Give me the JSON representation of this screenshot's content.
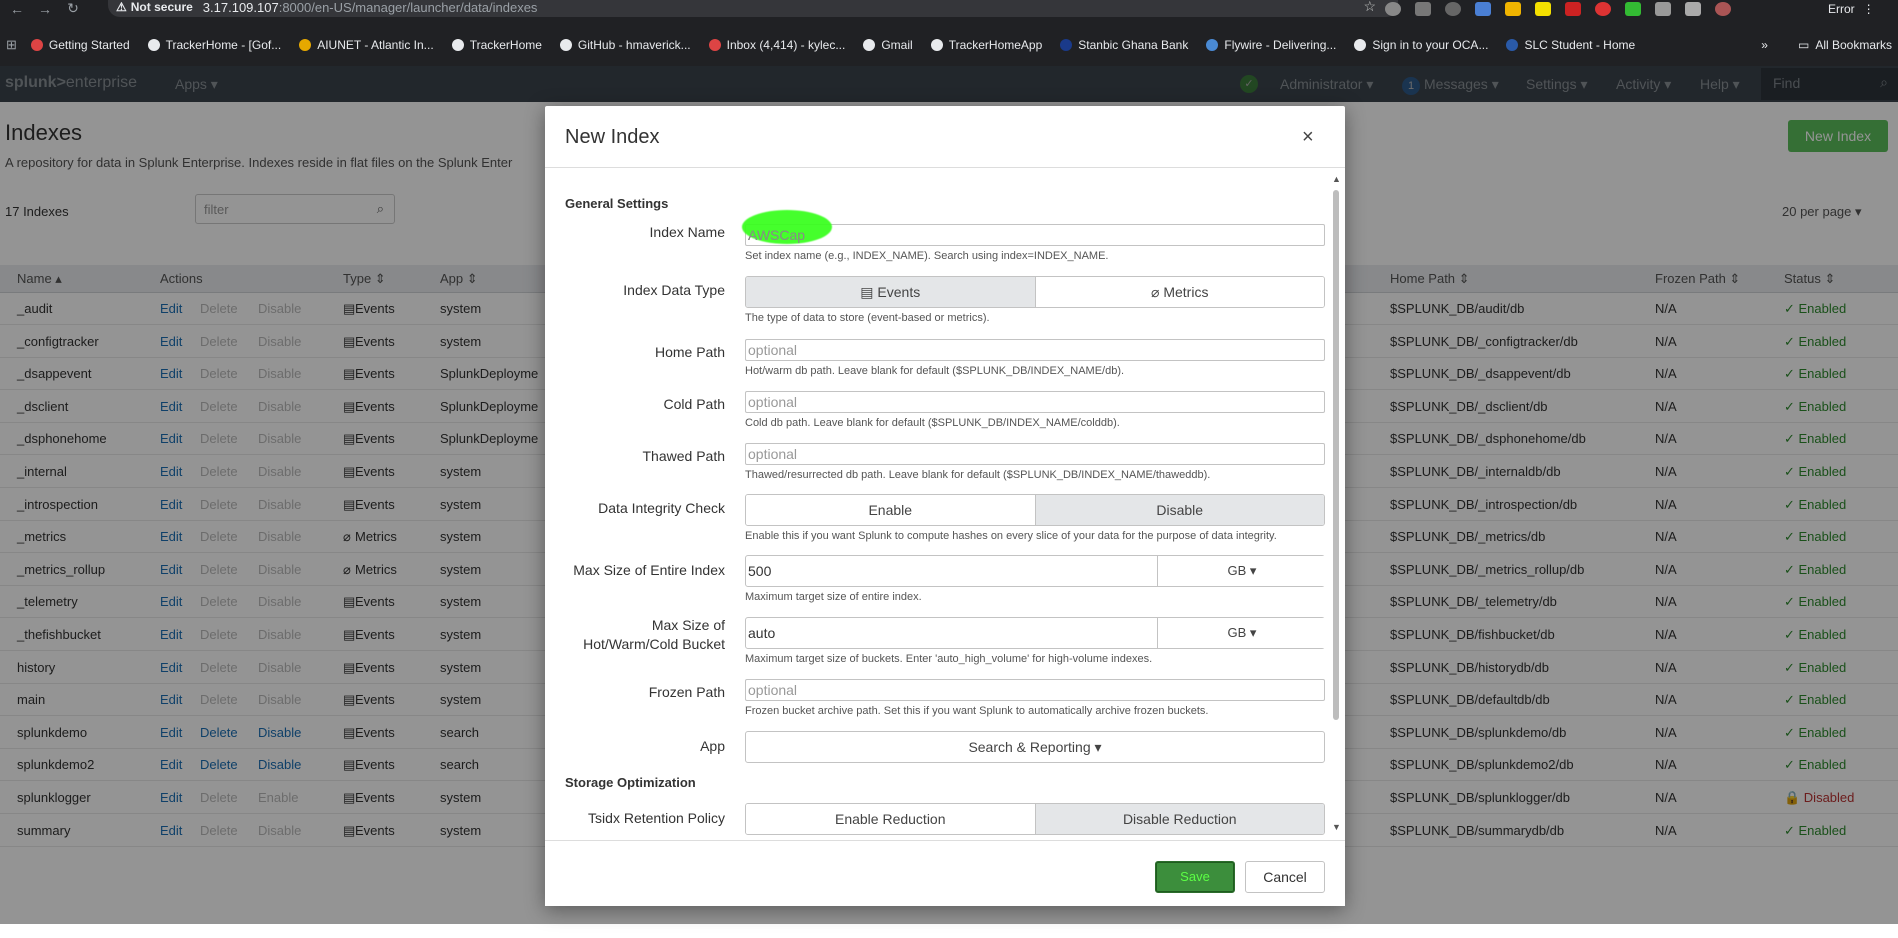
{
  "browser": {
    "not_secure": "Not secure",
    "url_host": "3.17.109.107",
    "url_path": ":8000/en-US/manager/launcher/data/indexes",
    "error_label": "Error",
    "bookmarks": [
      "Getting Started",
      "TrackerHome - [Gof...",
      "AIUNET - Atlantic In...",
      "TrackerHome",
      "GitHub - hmaverick...",
      "Inbox (4,414) - kylec...",
      "Gmail",
      "TrackerHomeApp",
      "Stanbic Ghana Bank",
      "Flywire - Delivering...",
      "Sign in to your OCA...",
      "SLC Student - Home"
    ],
    "all_bookmarks": "All Bookmarks"
  },
  "splunk": {
    "logo_a": "splunk>",
    "logo_b": "enterprise",
    "apps": "Apps ▾",
    "admin": "Administrator ▾",
    "messages_count": "1",
    "messages": "Messages ▾",
    "settings": "Settings ▾",
    "activity": "Activity ▾",
    "help": "Help ▾",
    "find": "Find"
  },
  "page": {
    "title": "Indexes",
    "description": "A repository for data in Splunk Enterprise. Indexes reside in flat files on the Splunk Enter",
    "new_index": "New Index",
    "count": "17 Indexes",
    "filter_placeholder": "filter",
    "per_page": "20 per page ▾",
    "columns": {
      "name": "Name ▴",
      "actions": "Actions",
      "type": "Type ⇕",
      "app": "App ⇕",
      "home_path": "Home Path ⇕",
      "frozen_path": "Frozen Path ⇕",
      "status": "Status ⇕"
    },
    "rows": [
      {
        "name": "_audit",
        "type": "Events",
        "app": "system",
        "home": "$SPLUNK_DB/audit/db",
        "frozen": "N/A",
        "status": "✓ Enabled",
        "editable": false
      },
      {
        "name": "_configtracker",
        "type": "Events",
        "app": "system",
        "home": "$SPLUNK_DB/_configtracker/db",
        "frozen": "N/A",
        "status": "✓ Enabled",
        "editable": false
      },
      {
        "name": "_dsappevent",
        "type": "Events",
        "app": "SplunkDeployme",
        "home": "$SPLUNK_DB/_dsappevent/db",
        "frozen": "N/A",
        "status": "✓ Enabled",
        "editable": false
      },
      {
        "name": "_dsclient",
        "type": "Events",
        "app": "SplunkDeployme",
        "home": "$SPLUNK_DB/_dsclient/db",
        "frozen": "N/A",
        "status": "✓ Enabled",
        "editable": false
      },
      {
        "name": "_dsphonehome",
        "type": "Events",
        "app": "SplunkDeployme",
        "home": "$SPLUNK_DB/_dsphonehome/db",
        "frozen": "N/A",
        "status": "✓ Enabled",
        "editable": false
      },
      {
        "name": "_internal",
        "type": "Events",
        "app": "system",
        "home": "$SPLUNK_DB/_internaldb/db",
        "frozen": "N/A",
        "status": "✓ Enabled",
        "editable": false
      },
      {
        "name": "_introspection",
        "type": "Events",
        "app": "system",
        "home": "$SPLUNK_DB/_introspection/db",
        "frozen": "N/A",
        "status": "✓ Enabled",
        "editable": false
      },
      {
        "name": "_metrics",
        "type": "Metrics",
        "app": "system",
        "home": "$SPLUNK_DB/_metrics/db",
        "frozen": "N/A",
        "status": "✓ Enabled",
        "editable": false
      },
      {
        "name": "_metrics_rollup",
        "type": "Metrics",
        "app": "system",
        "home": "$SPLUNK_DB/_metrics_rollup/db",
        "frozen": "N/A",
        "status": "✓ Enabled",
        "editable": false
      },
      {
        "name": "_telemetry",
        "type": "Events",
        "app": "system",
        "home": "$SPLUNK_DB/_telemetry/db",
        "frozen": "N/A",
        "status": "✓ Enabled",
        "editable": false
      },
      {
        "name": "_thefishbucket",
        "type": "Events",
        "app": "system",
        "home": "$SPLUNK_DB/fishbucket/db",
        "frozen": "N/A",
        "status": "✓ Enabled",
        "editable": false
      },
      {
        "name": "history",
        "type": "Events",
        "app": "system",
        "home": "$SPLUNK_DB/historydb/db",
        "frozen": "N/A",
        "status": "✓ Enabled",
        "editable": false
      },
      {
        "name": "main",
        "type": "Events",
        "app": "system",
        "home": "$SPLUNK_DB/defaultdb/db",
        "frozen": "N/A",
        "status": "✓ Enabled",
        "editable": false
      },
      {
        "name": "splunkdemo",
        "type": "Events",
        "app": "search",
        "home": "$SPLUNK_DB/splunkdemo/db",
        "frozen": "N/A",
        "status": "✓ Enabled",
        "editable": true
      },
      {
        "name": "splunkdemo2",
        "type": "Events",
        "app": "search",
        "home": "$SPLUNK_DB/splunkdemo2/db",
        "frozen": "N/A",
        "status": "✓ Enabled",
        "editable": true
      },
      {
        "name": "splunklogger",
        "type": "Events",
        "app": "system",
        "home": "$SPLUNK_DB/splunklogger/db",
        "frozen": "N/A",
        "status": "🔒 Disabled",
        "editable": false
      },
      {
        "name": "summary",
        "type": "Events",
        "app": "system",
        "home": "$SPLUNK_DB/summarydb/db",
        "frozen": "N/A",
        "status": "✓ Enabled",
        "editable": false
      }
    ],
    "action_edit": "Edit",
    "action_delete": "Delete",
    "action_disable": "Disable",
    "action_enable": "Enable"
  },
  "modal": {
    "title": "New Index",
    "close": "×",
    "general_settings": "General Settings",
    "index_name_label": "Index Name",
    "index_name_value": "AWSCap",
    "index_name_help": "Set index name (e.g., INDEX_NAME). Search using index=INDEX_NAME.",
    "data_type_label": "Index Data Type",
    "data_type_events": "Events",
    "data_type_metrics": "Metrics",
    "data_type_help": "The type of data to store (event-based or metrics).",
    "home_path_label": "Home Path",
    "home_path_placeholder": "optional",
    "home_path_help": "Hot/warm db path. Leave blank for default ($SPLUNK_DB/INDEX_NAME/db).",
    "cold_path_label": "Cold Path",
    "cold_path_placeholder": "optional",
    "cold_path_help": "Cold db path. Leave blank for default ($SPLUNK_DB/INDEX_NAME/colddb).",
    "thawed_path_label": "Thawed Path",
    "thawed_path_placeholder": "optional",
    "thawed_path_help": "Thawed/resurrected db path. Leave blank for default ($SPLUNK_DB/INDEX_NAME/thaweddb).",
    "integrity_label": "Data Integrity Check",
    "integrity_enable": "Enable",
    "integrity_disable": "Disable",
    "integrity_help": "Enable this if you want Splunk to compute hashes on every slice of your data for the purpose of data integrity.",
    "max_size_label": "Max Size of Entire Index",
    "max_size_value": "500",
    "max_size_unit": "GB ▾",
    "max_size_help": "Maximum target size of entire index.",
    "bucket_label_1": "Max Size of",
    "bucket_label_2": "Hot/Warm/Cold Bucket",
    "bucket_value": "auto",
    "bucket_unit": "GB ▾",
    "bucket_help": "Maximum target size of buckets. Enter 'auto_high_volume' for high-volume indexes.",
    "frozen_label": "Frozen Path",
    "frozen_placeholder": "optional",
    "frozen_help": "Frozen bucket archive path. Set this if you want Splunk to automatically archive frozen buckets.",
    "app_label": "App",
    "app_value": "Search & Reporting ▾",
    "storage_opt": "Storage Optimization",
    "tsidx_label": "Tsidx Retention Policy",
    "tsidx_enable": "Enable Reduction",
    "tsidx_disable": "Disable Reduction",
    "save": "Save",
    "cancel": "Cancel"
  }
}
